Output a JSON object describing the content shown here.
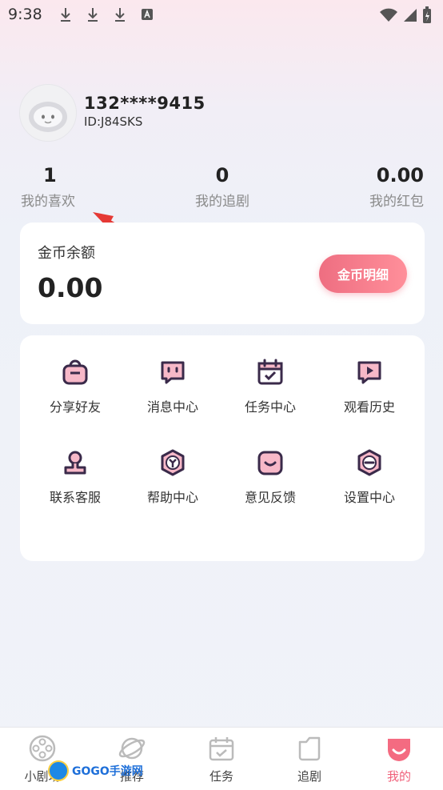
{
  "status_bar": {
    "time": "9:38"
  },
  "profile": {
    "phone": "132****9415",
    "id": "ID:J84SKS"
  },
  "stats": [
    {
      "value": "1",
      "label": "我的喜欢"
    },
    {
      "value": "0",
      "label": "我的追剧"
    },
    {
      "value": "0.00",
      "label": "我的红包"
    }
  ],
  "coin": {
    "title": "金币余额",
    "value": "0.00",
    "button": "金币明细"
  },
  "menu": [
    {
      "label": "分享好友",
      "icon": "share-bag-icon"
    },
    {
      "label": "消息中心",
      "icon": "message-icon"
    },
    {
      "label": "任务中心",
      "icon": "calendar-check-icon"
    },
    {
      "label": "观看历史",
      "icon": "play-history-icon"
    },
    {
      "label": "联系客服",
      "icon": "person-icon"
    },
    {
      "label": "帮助中心",
      "icon": "help-icon"
    },
    {
      "label": "意见反馈",
      "icon": "feedback-icon"
    },
    {
      "label": "设置中心",
      "icon": "settings-icon"
    }
  ],
  "tabs": [
    {
      "label": "小剧场",
      "icon": "film-reel-icon"
    },
    {
      "label": "推荐",
      "icon": "planet-icon"
    },
    {
      "label": "任务",
      "icon": "calendar-icon"
    },
    {
      "label": "追剧",
      "icon": "folder-icon"
    },
    {
      "label": "我的",
      "icon": "me-icon",
      "active": true
    }
  ],
  "watermark": {
    "text": "GOGO手游网"
  },
  "colors": {
    "accent": "#f0607a",
    "icon_dark": "#3a2a4a",
    "icon_pink": "#f7b8c8"
  }
}
